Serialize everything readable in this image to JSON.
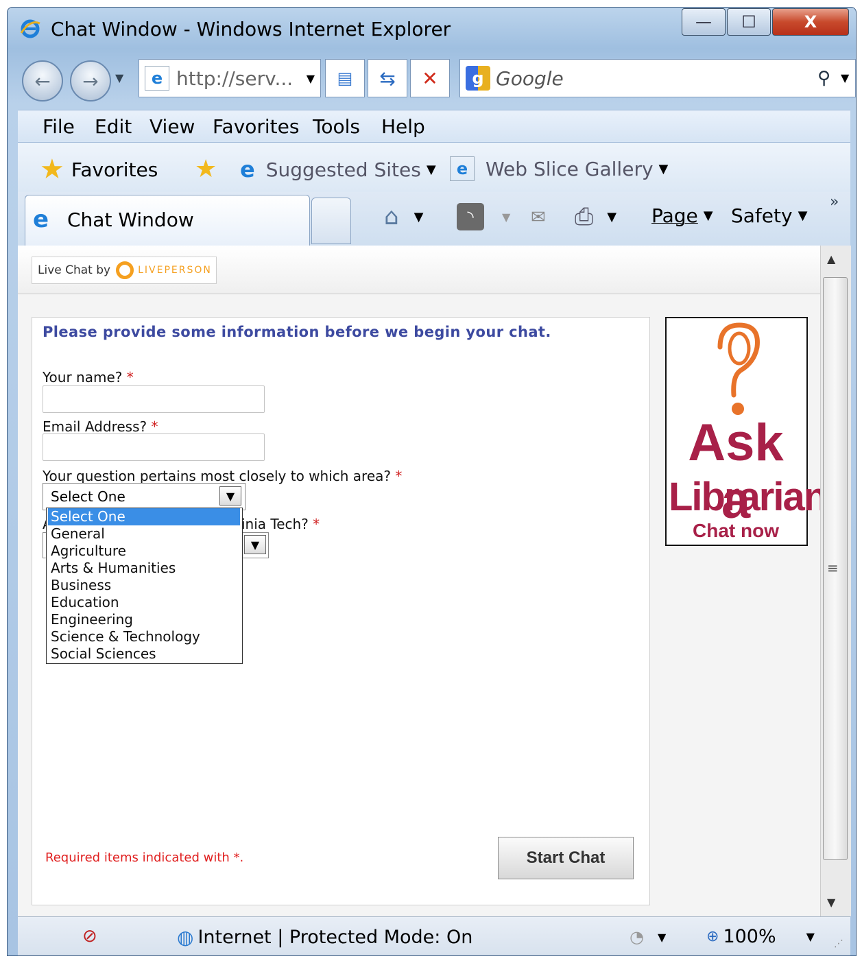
{
  "window": {
    "title": "Chat Window - Windows Internet Explorer",
    "minimize": "—",
    "maximize": "☐",
    "close": "X"
  },
  "navbar": {
    "address": "http://serv...",
    "search_placeholder": "Google"
  },
  "menu": {
    "items": [
      "File",
      "Edit",
      "View",
      "Favorites",
      "Tools",
      "Help"
    ]
  },
  "favorites_bar": {
    "favorites_label": "Favorites",
    "suggested_sites": "Suggested Sites",
    "web_slice_gallery": "Web Slice Gallery"
  },
  "tabs": {
    "active_tab": "Chat Window"
  },
  "command_bar": {
    "page": "Page",
    "safety": "Safety",
    "chevron": "»"
  },
  "liveperson": {
    "prefix": "Live Chat by",
    "brand": "LIVEPERSON"
  },
  "form": {
    "intro": "Please provide some information before we begin your chat.",
    "name_label": "Your name?",
    "email_label": "Email Address?",
    "area_label": "Your question pertains most closely to which area?",
    "second_label_visible": "inia Tech?",
    "second_label_prefix": "A",
    "required_star": "*",
    "area_selected": "Select One",
    "area_options": [
      "Select One",
      "General",
      "Agriculture",
      "Arts & Humanities",
      "Business",
      "Education",
      "Engineering",
      "Science & Technology",
      "Social Sciences"
    ],
    "required_note": "Required items indicated with *.",
    "start_chat": "Start Chat"
  },
  "banner": {
    "line1": "Ask a",
    "line2": "Librarian",
    "line3": "Chat now"
  },
  "statusbar": {
    "zone": "Internet | Protected Mode: On",
    "zoom": "100%"
  },
  "colors": {
    "intro": "#3d4aa0",
    "required": "#e02020",
    "banner": "#a82048",
    "banner_accent": "#e8732a",
    "select_highlight": "#3a8ee6"
  }
}
